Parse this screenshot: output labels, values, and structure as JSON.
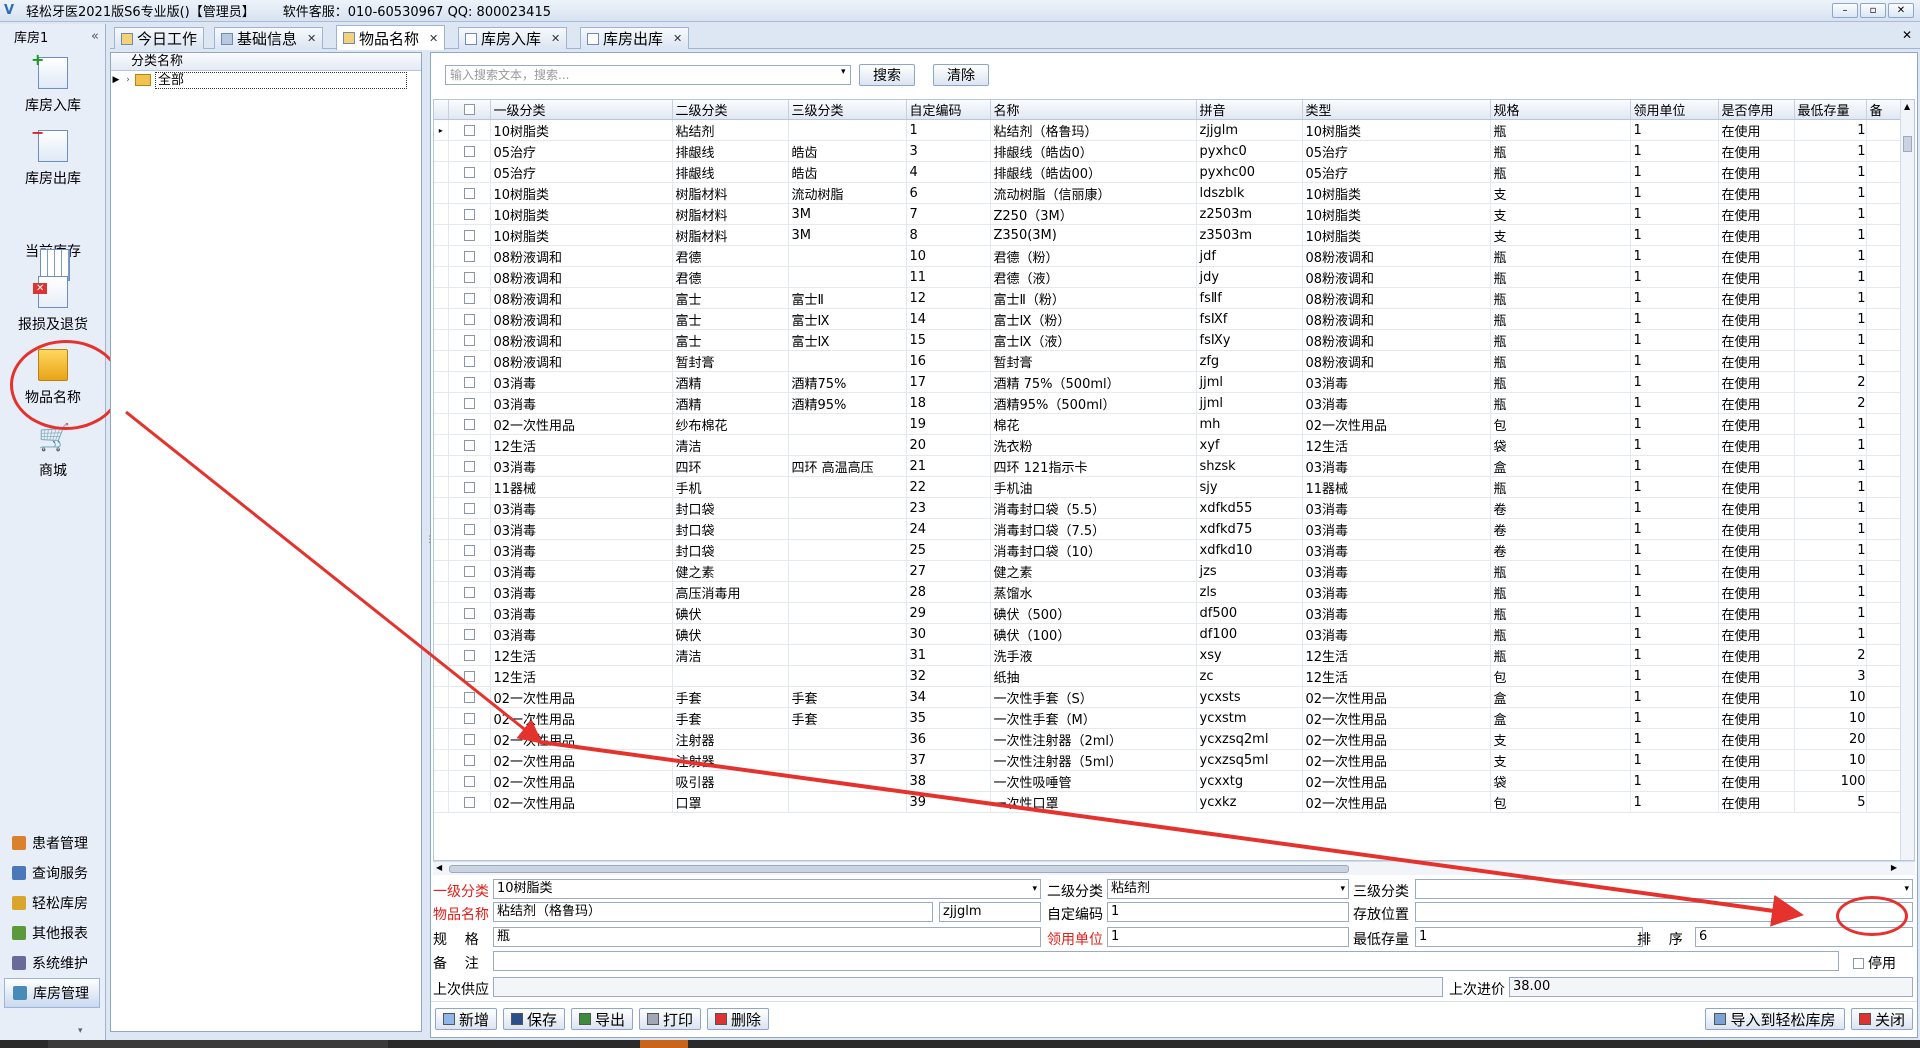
{
  "titlebar": {
    "title": "轻松牙医2021版S6专业版()【管理员】",
    "support": "软件客服：010-60530967 QQ: 800023415",
    "min": "–",
    "max": "▫",
    "close": "✕"
  },
  "leftnav": {
    "header": "库房1",
    "collapse": "«",
    "items": [
      {
        "label": "库房入库",
        "icon": "inbound-icon"
      },
      {
        "label": "库房出库",
        "icon": "outbound-icon"
      },
      {
        "label": "当前库存",
        "icon": "inventory-icon"
      },
      {
        "label": "报损及退货",
        "icon": "loss-return-icon"
      },
      {
        "label": "物品名称",
        "icon": "item-name-icon"
      },
      {
        "label": "商城",
        "icon": "cart-icon"
      }
    ],
    "modules": [
      {
        "label": "患者管理",
        "color": "#d9822b"
      },
      {
        "label": "查询服务",
        "color": "#4a78b8"
      },
      {
        "label": "轻松库房",
        "color": "#d9a62b"
      },
      {
        "label": "其他报表",
        "color": "#5a9a3a"
      },
      {
        "label": "系统维护",
        "color": "#6a6a9a"
      },
      {
        "label": "库房管理",
        "color": "#4a8ab8"
      }
    ]
  },
  "tabs": [
    {
      "label": "今日工作",
      "closable": false
    },
    {
      "label": "基础信息",
      "closable": true
    },
    {
      "label": "物品名称",
      "closable": true,
      "active": true
    },
    {
      "label": "库房入库",
      "closable": true
    },
    {
      "label": "库房出库",
      "closable": true
    }
  ],
  "tree": {
    "header": "分类名称",
    "root": "全部"
  },
  "search": {
    "placeholder": "输入搜索文本，搜索...",
    "search_label": "搜索",
    "clear_label": "清除"
  },
  "grid": {
    "columns": [
      "一级分类",
      "二级分类",
      "三级分类",
      "自定编码",
      "名称",
      "拼音",
      "类型",
      "规格",
      "领用单位",
      "是否停用",
      "最低存量",
      "备"
    ],
    "rows": [
      [
        "10树脂类",
        "粘结剂",
        "",
        "1",
        "粘结剂（格鲁玛）",
        "zjjglm",
        "10树脂类",
        "瓶",
        "1",
        "在使用",
        "1"
      ],
      [
        "05治疗",
        "排龈线",
        "皓齿",
        "3",
        "排龈线（皓齿0）",
        "pyxhc0",
        "05治疗",
        "瓶",
        "1",
        "在使用",
        "1"
      ],
      [
        "05治疗",
        "排龈线",
        "皓齿",
        "4",
        "排龈线（皓齿00）",
        "pyxhc00",
        "05治疗",
        "瓶",
        "1",
        "在使用",
        "1"
      ],
      [
        "10树脂类",
        "树脂材料",
        "流动树脂",
        "6",
        "流动树脂（信丽康）",
        "ldszblk",
        "10树脂类",
        "支",
        "1",
        "在使用",
        "1"
      ],
      [
        "10树脂类",
        "树脂材料",
        "3M",
        "7",
        "Z250（3M）",
        "z2503m",
        "10树脂类",
        "支",
        "1",
        "在使用",
        "1"
      ],
      [
        "10树脂类",
        "树脂材料",
        "3M",
        "8",
        "Z350(3M)",
        "z3503m",
        "10树脂类",
        "支",
        "1",
        "在使用",
        "1"
      ],
      [
        "08粉液调和",
        "君德",
        "",
        "10",
        "君德（粉）",
        "jdf",
        "08粉液调和",
        "瓶",
        "1",
        "在使用",
        "1"
      ],
      [
        "08粉液调和",
        "君德",
        "",
        "11",
        "君德（液）",
        "jdy",
        "08粉液调和",
        "瓶",
        "1",
        "在使用",
        "1"
      ],
      [
        "08粉液调和",
        "富士",
        "富士Ⅱ",
        "12",
        "富士Ⅱ（粉）",
        "fsⅡf",
        "08粉液调和",
        "瓶",
        "1",
        "在使用",
        "1"
      ],
      [
        "08粉液调和",
        "富士",
        "富士Ⅸ",
        "14",
        "富士Ⅸ（粉）",
        "fsⅨf",
        "08粉液调和",
        "瓶",
        "1",
        "在使用",
        "1"
      ],
      [
        "08粉液调和",
        "富士",
        "富士Ⅸ",
        "15",
        "富士Ⅸ（液）",
        "fsⅨy",
        "08粉液调和",
        "瓶",
        "1",
        "在使用",
        "1"
      ],
      [
        "08粉液调和",
        "暂封膏",
        "",
        "16",
        "暂封膏",
        "zfg",
        "08粉液调和",
        "瓶",
        "1",
        "在使用",
        "1"
      ],
      [
        "03消毒",
        "酒精",
        "酒精75%",
        "17",
        "酒精 75%（500ml）",
        "jjml",
        "03消毒",
        "瓶",
        "1",
        "在使用",
        "2"
      ],
      [
        "03消毒",
        "酒精",
        "酒精95%",
        "18",
        "酒精95%（500ml）",
        "jjml",
        "03消毒",
        "瓶",
        "1",
        "在使用",
        "2"
      ],
      [
        "02一次性用品",
        "纱布棉花",
        "",
        "19",
        "棉花",
        "mh",
        "02一次性用品",
        "包",
        "1",
        "在使用",
        "1"
      ],
      [
        "12生活",
        "清洁",
        "",
        "20",
        "洗衣粉",
        "xyf",
        "12生活",
        "袋",
        "1",
        "在使用",
        "1"
      ],
      [
        "03消毒",
        "四环",
        "四环 高温高压",
        "21",
        "四环 121指示卡",
        "shzsk",
        "03消毒",
        "盒",
        "1",
        "在使用",
        "1"
      ],
      [
        "11器械",
        "手机",
        "",
        "22",
        "手机油",
        "sjy",
        "11器械",
        "瓶",
        "1",
        "在使用",
        "1"
      ],
      [
        "03消毒",
        "封口袋",
        "",
        "23",
        "消毒封口袋（5.5）",
        "xdfkd55",
        "03消毒",
        "卷",
        "1",
        "在使用",
        "1"
      ],
      [
        "03消毒",
        "封口袋",
        "",
        "24",
        "消毒封口袋（7.5）",
        "xdfkd75",
        "03消毒",
        "卷",
        "1",
        "在使用",
        "1"
      ],
      [
        "03消毒",
        "封口袋",
        "",
        "25",
        "消毒封口袋（10）",
        "xdfkd10",
        "03消毒",
        "卷",
        "1",
        "在使用",
        "1"
      ],
      [
        "03消毒",
        "健之素",
        "",
        "27",
        "健之素",
        "jzs",
        "03消毒",
        "瓶",
        "1",
        "在使用",
        "1"
      ],
      [
        "03消毒",
        "高压消毒用",
        "",
        "28",
        "蒸馏水",
        "zls",
        "03消毒",
        "瓶",
        "1",
        "在使用",
        "1"
      ],
      [
        "03消毒",
        "碘伏",
        "",
        "29",
        "碘伏（500）",
        "df500",
        "03消毒",
        "瓶",
        "1",
        "在使用",
        "1"
      ],
      [
        "03消毒",
        "碘伏",
        "",
        "30",
        "碘伏（100）",
        "df100",
        "03消毒",
        "瓶",
        "1",
        "在使用",
        "1"
      ],
      [
        "12生活",
        "清洁",
        "",
        "31",
        "洗手液",
        "xsy",
        "12生活",
        "瓶",
        "1",
        "在使用",
        "2"
      ],
      [
        "12生活",
        "",
        "",
        "32",
        "纸抽",
        "zc",
        "12生活",
        "包",
        "1",
        "在使用",
        "3"
      ],
      [
        "02一次性用品",
        "手套",
        "手套",
        "34",
        "一次性手套（S）",
        "ycxsts",
        "02一次性用品",
        "盒",
        "1",
        "在使用",
        "10"
      ],
      [
        "02一次性用品",
        "手套",
        "手套",
        "35",
        "一次性手套（M）",
        "ycxstm",
        "02一次性用品",
        "盒",
        "1",
        "在使用",
        "10"
      ],
      [
        "02一次性用品",
        "注射器",
        "",
        "36",
        "一次性注射器（2ml）",
        "ycxzsq2ml",
        "02一次性用品",
        "支",
        "1",
        "在使用",
        "20"
      ],
      [
        "02一次性用品",
        "注射器",
        "",
        "37",
        "一次性注射器（5ml）",
        "ycxzsq5ml",
        "02一次性用品",
        "支",
        "1",
        "在使用",
        "10"
      ],
      [
        "02一次性用品",
        "吸引器",
        "",
        "38",
        "一次性吸唾管",
        "ycxxtg",
        "02一次性用品",
        "袋",
        "1",
        "在使用",
        "100"
      ],
      [
        "02一次性用品",
        "口罩",
        "",
        "39",
        "一次性口罩",
        "ycxkz",
        "02一次性用品",
        "包",
        "1",
        "在使用",
        "5"
      ]
    ]
  },
  "form": {
    "cat1_label": "一级分类",
    "cat1_value": "10树脂类",
    "cat2_label": "二级分类",
    "cat2_value": "粘结剂",
    "cat3_label": "三级分类",
    "cat3_value": "",
    "name_label": "物品名称",
    "name_value": "粘结剂（格鲁玛）",
    "pinyin_value": "zjjglm",
    "code_label": "自定编码",
    "code_value": "1",
    "location_label": "存放位置",
    "location_value": "",
    "spec_label": "规    格",
    "spec_value": "瓶",
    "unit_label": "领用单位",
    "unit_value": "1",
    "min_label": "最低存量",
    "min_value": "1",
    "sort_label": "排    序",
    "sort_value": "6",
    "note_label": "备    注",
    "note_value": "",
    "disable_label": "停用",
    "supplier_label": "上次供应",
    "supplier_value": "",
    "price_label": "上次进价",
    "price_value": "38.00"
  },
  "toolbar": {
    "add": "新增",
    "save": "保存",
    "export": "导出",
    "print": "打印",
    "delete": "删除",
    "import": "导入到轻松库房",
    "close": "关闭"
  },
  "colors": {
    "annotation_red": "#e5322d",
    "required_label": "#e0201b"
  }
}
